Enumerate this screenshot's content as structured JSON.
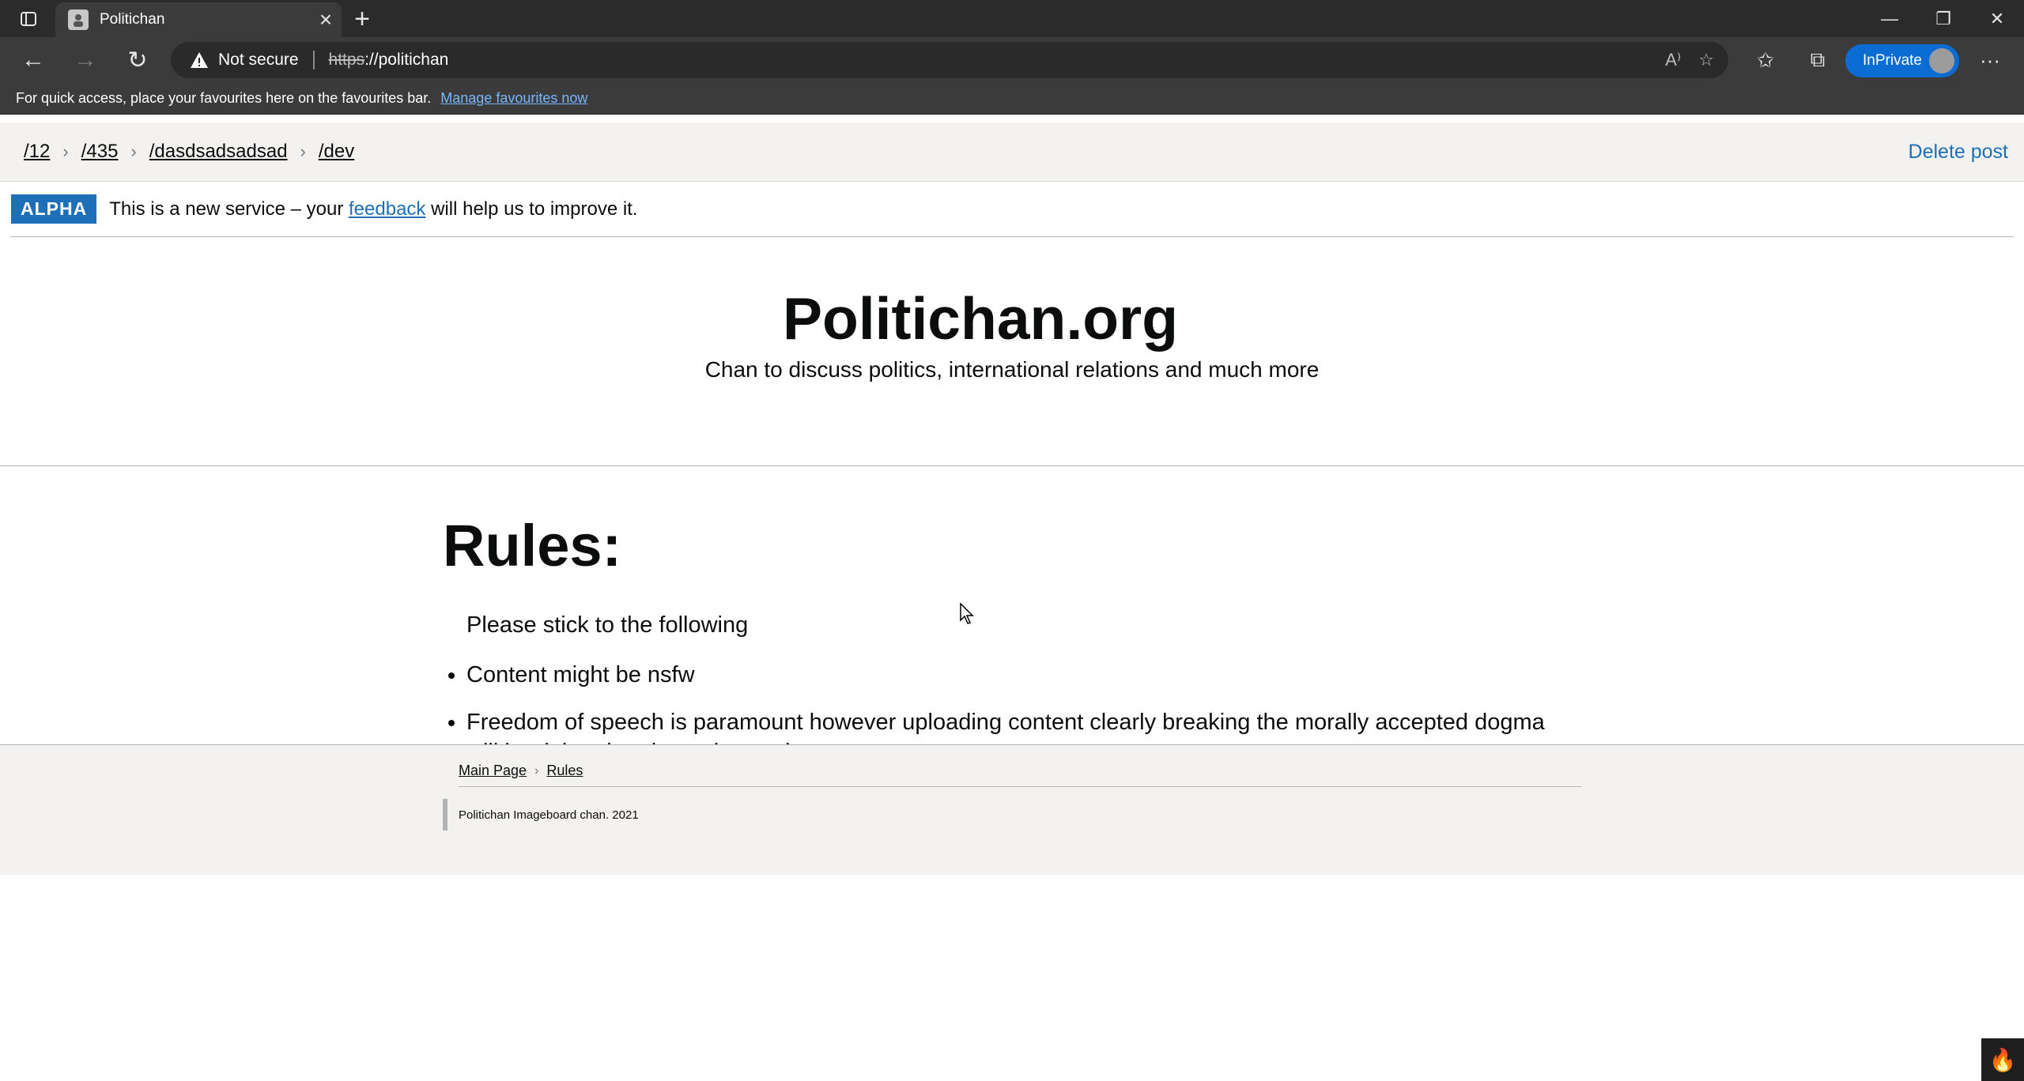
{
  "browser": {
    "tab_title": "Politichan",
    "address": {
      "security_label": "Not secure",
      "url_scheme": "https",
      "url_rest": "://politichan"
    },
    "inprivate_label": "InPrivate",
    "favourites_bar": {
      "message": "For quick access, place your favourites here on the favourites bar.",
      "link": "Manage favourites now"
    }
  },
  "breadcrumb": {
    "items": [
      "/12",
      "/435",
      "/dasdsadsadsad",
      "/dev"
    ],
    "delete_label": "Delete post"
  },
  "phase_banner": {
    "tag": "ALPHA",
    "text_before": "This is a new service – your",
    "link": "feedback",
    "text_after": "will help us to improve it."
  },
  "hero": {
    "title": "Politichan.org",
    "tagline": "Chan to discuss politics, international relations and much more"
  },
  "rules": {
    "heading": "Rules:",
    "intro": "Please stick to the following",
    "items": [
      "Content might be nsfw",
      "Freedom of speech is paramount however uploading content clearly breaking the morally accepted dogma will be deleted and user banned"
    ]
  },
  "footer": {
    "crumbs": [
      "Main Page",
      "Rules"
    ],
    "copyright": "Politichan Imageboard chan. 2021"
  },
  "colors": {
    "accent": "#1d70b8",
    "inprivate": "#0b6dd3",
    "chrome_bg": "#3b3b3b"
  }
}
